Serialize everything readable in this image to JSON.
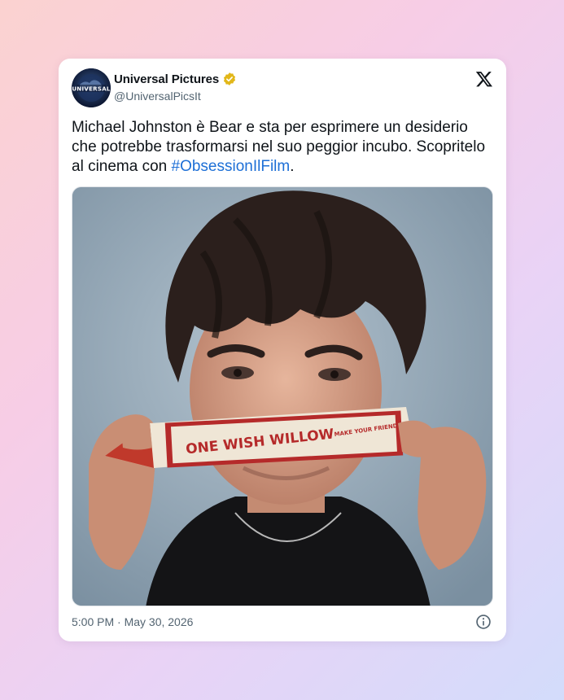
{
  "account": {
    "display_name": "Universal Pictures",
    "handle": "@UniversalPicsIt",
    "avatar_text": "UNIVERSAL"
  },
  "tweet": {
    "text_part1": "Michael Johnston è Bear e sta per esprimere un desiderio che potrebbe trasformarsi nel suo peggior incubo. Scopritelo al cinema con ",
    "hashtag": "#ObsessionIlFilm",
    "text_part2": "."
  },
  "media": {
    "alt": "",
    "box_text": "ONE WISH WILLOW",
    "box_side_text": "MAKE YOUR FRIENDS!"
  },
  "footer": {
    "timestamp": "5:00 PM · May 30, 2026"
  },
  "icons": {
    "verified": "verified-badge-icon",
    "platform": "x-logo-icon",
    "info": "info-icon"
  },
  "colors": {
    "link": "#1d6fd6",
    "verified_gold": "#e2b719",
    "text_primary": "#0f1419",
    "text_secondary": "#536471"
  }
}
